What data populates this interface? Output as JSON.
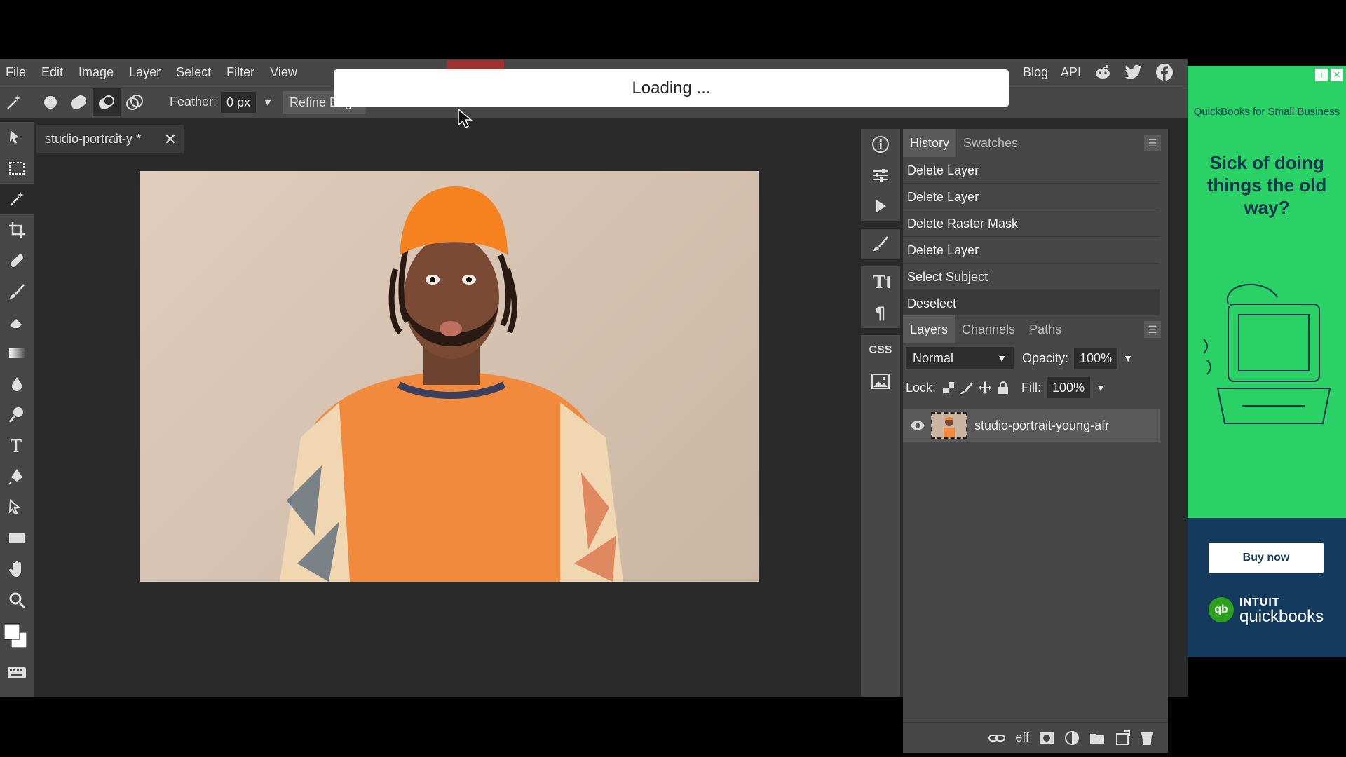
{
  "menu": {
    "items": [
      "File",
      "Edit",
      "Image",
      "Layer",
      "Select",
      "Filter",
      "View"
    ],
    "right_items": [
      "Blog",
      "API"
    ]
  },
  "options": {
    "feather_label": "Feather:",
    "feather_value": "0 px",
    "refine_edge": "Refine Edge"
  },
  "document": {
    "tab_title": "studio-portrait-y *"
  },
  "loading": {
    "text": "Loading ..."
  },
  "history": {
    "tabs": [
      "History",
      "Swatches"
    ],
    "items": [
      "Delete Layer",
      "Delete Layer",
      "Delete Raster Mask",
      "Delete Layer",
      "Select Subject",
      "Deselect"
    ]
  },
  "layers": {
    "tabs": [
      "Layers",
      "Channels",
      "Paths"
    ],
    "blend_mode": "Normal",
    "opacity_label": "Opacity:",
    "opacity_value": "100%",
    "lock_label": "Lock:",
    "fill_label": "Fill:",
    "fill_value": "100%",
    "layer_name": "studio-portrait-young-afr"
  },
  "sidepanel": {
    "css_label": "CSS"
  },
  "footer": {
    "eff_label": "eff"
  },
  "ad": {
    "brand": "QuickBooks for Small Business",
    "headline": "Sick of doing things the old way?",
    "button": "Buy now",
    "logo_top": "INTUIT",
    "logo_bottom": "quickbooks",
    "logo_badge": "qb"
  },
  "colors": {
    "accent": "#2ad164",
    "panel": "#474747",
    "workspace": "#2a2a2a"
  }
}
